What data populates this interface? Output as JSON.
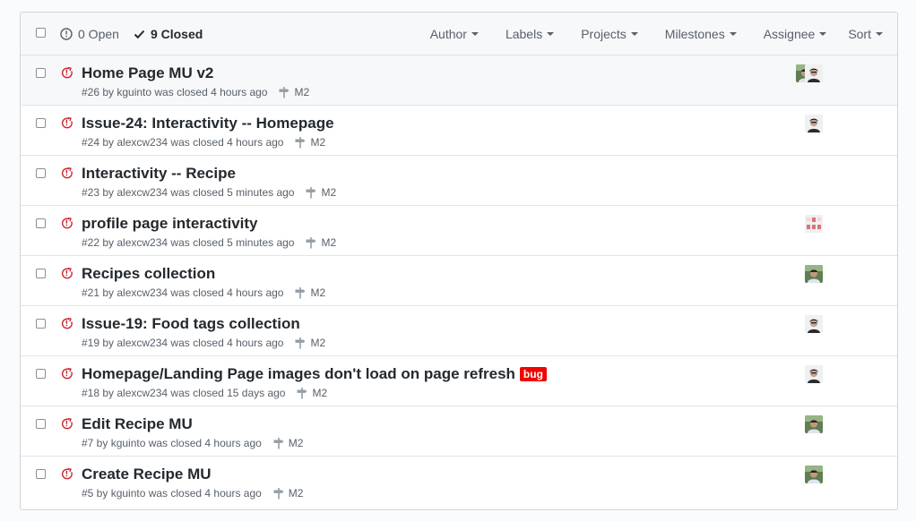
{
  "header": {
    "open_label": "0 Open",
    "closed_label": "9 Closed",
    "filters": [
      "Author",
      "Labels",
      "Projects",
      "Milestones",
      "Assignee",
      "Sort"
    ]
  },
  "issues": [
    {
      "title": "Home Page MU v2",
      "meta": "#26 by kguinto was closed 4 hours ago",
      "milestone": "M2",
      "label": "",
      "avatars": [
        "photo",
        "face"
      ]
    },
    {
      "title": "Issue-24: Interactivity -- Homepage",
      "meta": "#24 by alexcw234 was closed 4 hours ago",
      "milestone": "M2",
      "label": "",
      "avatars": [
        "face"
      ]
    },
    {
      "title": "Interactivity -- Recipe",
      "meta": "#23 by alexcw234 was closed 5 minutes ago",
      "milestone": "M2",
      "label": "",
      "avatars": []
    },
    {
      "title": "profile page interactivity",
      "meta": "#22 by alexcw234 was closed 5 minutes ago",
      "milestone": "M2",
      "label": "",
      "avatars": [
        "identicon"
      ]
    },
    {
      "title": "Recipes collection",
      "meta": "#21 by alexcw234 was closed 4 hours ago",
      "milestone": "M2",
      "label": "",
      "avatars": [
        "photo"
      ]
    },
    {
      "title": "Issue-19: Food tags collection",
      "meta": "#19 by alexcw234 was closed 4 hours ago",
      "milestone": "M2",
      "label": "",
      "avatars": [
        "face"
      ]
    },
    {
      "title": "Homepage/Landing Page images don't load on page refresh",
      "meta": "#18 by alexcw234 was closed 15 days ago",
      "milestone": "M2",
      "label": "bug",
      "avatars": [
        "face"
      ]
    },
    {
      "title": "Edit Recipe MU",
      "meta": "#7 by kguinto was closed 4 hours ago",
      "milestone": "M2",
      "label": "",
      "avatars": [
        "photo"
      ]
    },
    {
      "title": "Create Recipe MU",
      "meta": "#5 by kguinto was closed 4 hours ago",
      "milestone": "M2",
      "label": "",
      "avatars": [
        "photo"
      ]
    }
  ],
  "colors": {
    "closed_icon": "#cb2431",
    "bug_label": "#ee0701",
    "text": "#24292e",
    "muted": "#586069"
  }
}
